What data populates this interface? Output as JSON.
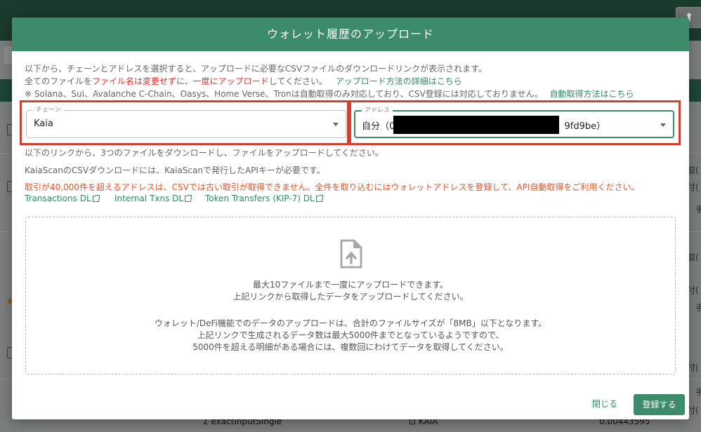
{
  "modal": {
    "title": "ウォレット履歴のアップロード",
    "info1": "以下から、チェーンとアドレスを選択すると、アップロードに必要なCSVファイルのダウンロードリンクが表示されます。",
    "info2_a": "全てのファイルを",
    "info2_b": "ファイル名は変更せず",
    "info2_c": "に、",
    "info2_d": "一度にアップロード",
    "info2_e": "してください。",
    "info2_link": "アップロード方法の詳細はこちら",
    "info3": "※ Solana、Sui、Avalanche C-Chain、Oasys、Home Verse、Tronは自動取得のみ対応しており、CSV登録には対応しておりません。",
    "info3_link": "自動取得方法はこちら",
    "chain_label": "チェーン",
    "chain_value": "Kaia",
    "address_label": "アドレス",
    "address_prefix": "自分（0x21",
    "address_suffix": "9fd9be）",
    "download_instructions": "以下のリンクから、3つのファイルをダウンロードし、ファイルをアップロードしてください。",
    "api_note": "KaiaScanのCSVダウンロードには、KaiaScanで発行したAPIキーが必要です。",
    "warning": "取引が40,000件を超えるアドレスは、CSVでは古い取引が取得できません。全件を取り込むにはウォレットアドレスを登録して、API自動取得をご利用ください。",
    "links": [
      "Transactions DL",
      "Internal Txns DL",
      "Token Transfers (KIP-7) DL"
    ],
    "dropzone": {
      "line1": "最大10ファイルまで一度にアップロードできます。",
      "line2": "上記リンクから取得したデータをアップロードしてください。",
      "line3": "ウォレット/DeFi機能でのデータのアップロードは、合計のファイルサイズが「8MB」以下となります。",
      "line4": "上記リンクで生成されるデータ数は最大5000件までとなっているようですので、",
      "line5": "5000件を超える明細がある場合には、複数回にわけてデータを取得してください。"
    },
    "close_label": "閉じる",
    "upload_label": "登録する"
  },
  "background": {
    "right_snippets": [
      "取(",
      "付(",
      "手",
      "取(",
      "付(",
      "手",
      "付(",
      "手",
      "付("
    ],
    "bottom_method": "exactInputSingle",
    "bottom_token": "KAIA",
    "bottom_amount": "0.00443595"
  },
  "colors": {
    "accent": "#3c8b6b",
    "highlight": "#d0412f",
    "warning": "#e0562a",
    "alert_red": "#e0312f"
  }
}
